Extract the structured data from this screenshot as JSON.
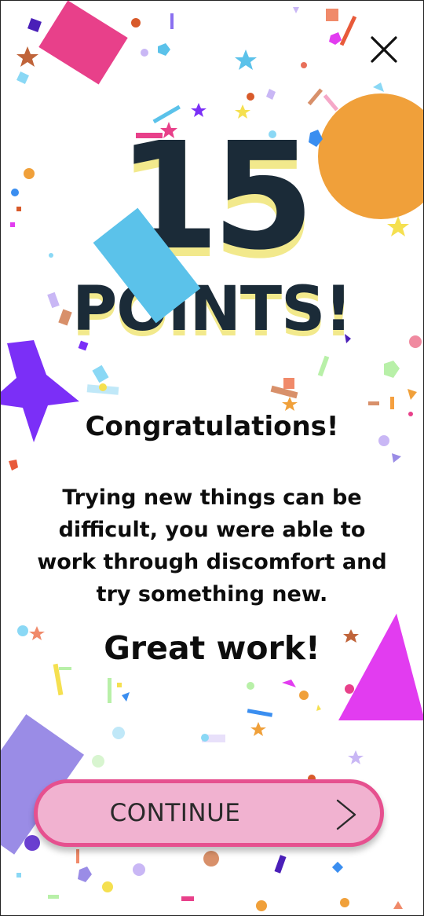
{
  "celebration": {
    "points_number": "15",
    "points_word": "POINTS!",
    "congrats": "Congratulations!",
    "message": "Trying new things can be difficult, you were able to work through discomfort and try something new.",
    "great_work": "Great work!"
  },
  "actions": {
    "continue_label": "CONTINUE",
    "continue_icon": "chevron-right-icon",
    "close_icon": "close-icon"
  },
  "colors": {
    "title": "#1b2b38",
    "title_shadow": "#f2e98c",
    "button_fill": "#f1b2d0",
    "button_border": "#e6508f",
    "accent_orange": "#f0a03a",
    "accent_purple": "#7b2ff7",
    "accent_magenta": "#e23cf0",
    "accent_blue": "#5bc2ea",
    "accent_lavender": "#9a8ce6",
    "accent_pink": "#e8408a"
  }
}
